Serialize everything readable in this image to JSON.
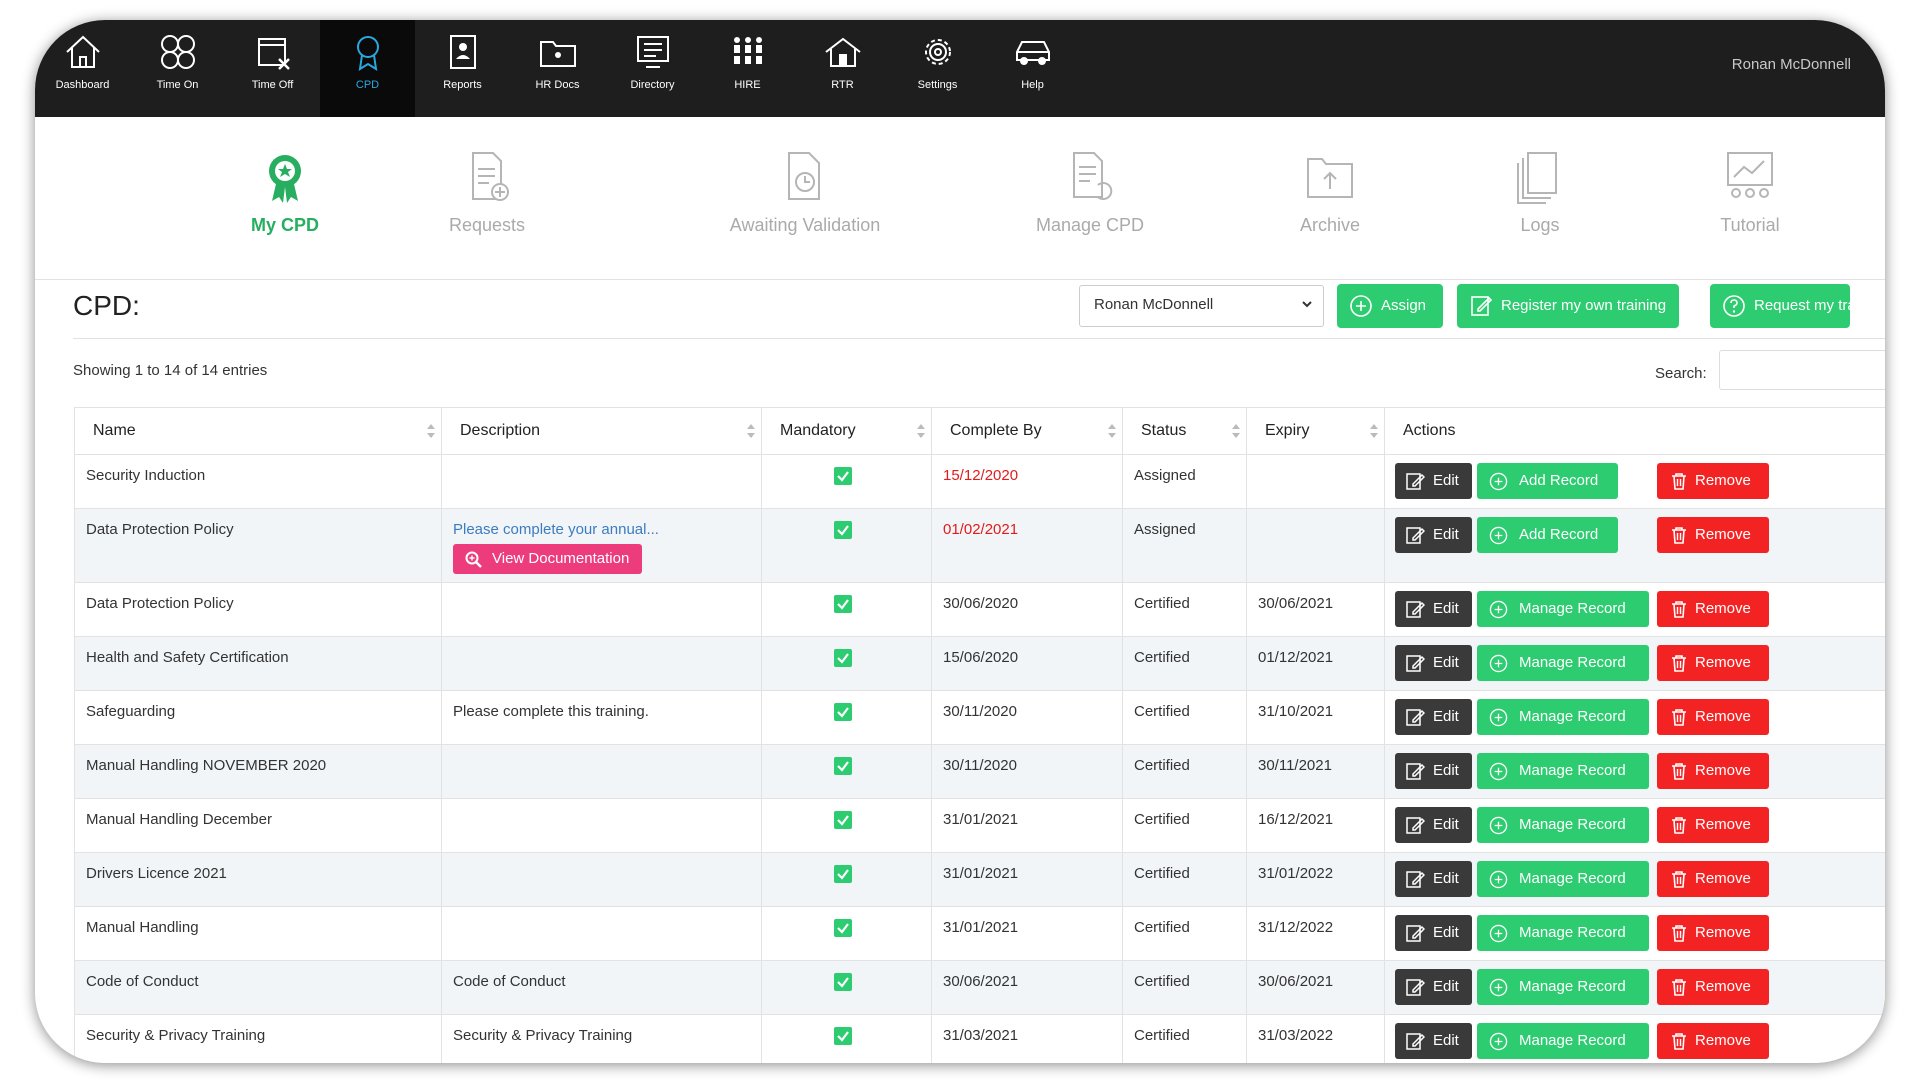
{
  "nav": {
    "items": [
      {
        "label": "Dashboard",
        "icon": "home-icon"
      },
      {
        "label": "Time On",
        "icon": "time-on-icon"
      },
      {
        "label": "Time Off",
        "icon": "time-off-calendar-icon"
      },
      {
        "label": "CPD",
        "icon": "cpd-award-icon",
        "active": true
      },
      {
        "label": "Reports",
        "icon": "reports-icon"
      },
      {
        "label": "HR Docs",
        "icon": "hr-docs-folder-icon"
      },
      {
        "label": "Directory",
        "icon": "directory-icon"
      },
      {
        "label": "HIRE",
        "icon": "hire-people-icon"
      },
      {
        "label": "RTR",
        "icon": "rtr-house-icon"
      },
      {
        "label": "Settings",
        "icon": "gear-icon"
      },
      {
        "label": "Help",
        "icon": "help-car-icon"
      }
    ],
    "user": "Ronan McDonnell"
  },
  "subnav": {
    "items": [
      {
        "label": "My CPD",
        "icon": "award-ribbon-icon",
        "active": true
      },
      {
        "label": "Requests",
        "icon": "document-plus-icon"
      },
      {
        "label": "Awaiting Validation",
        "icon": "document-clock-icon"
      },
      {
        "label": "Manage CPD",
        "icon": "document-refresh-icon"
      },
      {
        "label": "Archive",
        "icon": "archive-upload-icon"
      },
      {
        "label": "Logs",
        "icon": "logs-stack-icon"
      },
      {
        "label": "Tutorial",
        "icon": "tutorial-board-icon"
      }
    ]
  },
  "cpd": {
    "title": "CPD:",
    "selected_user": "Ronan McDonnell",
    "assign_label": "Assign",
    "register_label": "Register my own training",
    "request_label": "Request my training",
    "showing": "Showing 1 to 14 of 14 entries",
    "search_label": "Search:"
  },
  "table": {
    "headers": [
      "Name",
      "Description",
      "Mandatory",
      "Complete By",
      "Status",
      "Expiry",
      "Actions"
    ],
    "edit_label": "Edit",
    "add_record_label": "Add Record",
    "manage_record_label": "Manage Record",
    "remove_label": "Remove",
    "view_doc_label": "View Documentation",
    "rows": [
      {
        "name": "Security Induction",
        "description": "",
        "mandatory": true,
        "complete_by": "15/12/2020",
        "overdue": true,
        "status": "Assigned",
        "expiry": "",
        "action": "add"
      },
      {
        "name": "Data Protection Policy",
        "description": "Please complete your annual...",
        "has_doc": true,
        "mandatory": true,
        "complete_by": "01/02/2021",
        "overdue": true,
        "status": "Assigned",
        "expiry": "",
        "action": "add"
      },
      {
        "name": "Data Protection Policy",
        "description": "",
        "mandatory": true,
        "complete_by": "30/06/2020",
        "status": "Certified",
        "expiry": "30/06/2021",
        "action": "manage"
      },
      {
        "name": "Health and Safety Certification",
        "description": "",
        "mandatory": true,
        "complete_by": "15/06/2020",
        "status": "Certified",
        "expiry": "01/12/2021",
        "action": "manage"
      },
      {
        "name": "Safeguarding",
        "description": "Please complete this training.",
        "mandatory": true,
        "complete_by": "30/11/2020",
        "status": "Certified",
        "expiry": "31/10/2021",
        "action": "manage"
      },
      {
        "name": "Manual Handling NOVEMBER 2020",
        "description": "",
        "mandatory": true,
        "complete_by": "30/11/2020",
        "status": "Certified",
        "expiry": "30/11/2021",
        "action": "manage"
      },
      {
        "name": "Manual Handling December",
        "description": "",
        "mandatory": true,
        "complete_by": "31/01/2021",
        "status": "Certified",
        "expiry": "16/12/2021",
        "action": "manage"
      },
      {
        "name": "Drivers Licence 2021",
        "description": "",
        "mandatory": true,
        "complete_by": "31/01/2021",
        "status": "Certified",
        "expiry": "31/01/2022",
        "action": "manage"
      },
      {
        "name": "Manual Handling",
        "description": "",
        "mandatory": true,
        "complete_by": "31/01/2021",
        "status": "Certified",
        "expiry": "31/12/2022",
        "action": "manage"
      },
      {
        "name": "Code of Conduct",
        "description": "Code of Conduct",
        "mandatory": true,
        "complete_by": "30/06/2021",
        "status": "Certified",
        "expiry": "30/06/2021",
        "action": "manage"
      },
      {
        "name": "Security & Privacy Training",
        "description": "Security & Privacy Training",
        "mandatory": true,
        "complete_by": "31/03/2021",
        "status": "Certified",
        "expiry": "31/03/2022",
        "action": "manage"
      }
    ]
  },
  "colors": {
    "nav_bg": "#1e1e1e",
    "nav_active": "#29a8e0",
    "green": "#2ecc71",
    "red": "#f42323",
    "pink": "#ec3c7c",
    "dark_button": "#3a3a3a",
    "overdue_text": "#e01c1c"
  }
}
